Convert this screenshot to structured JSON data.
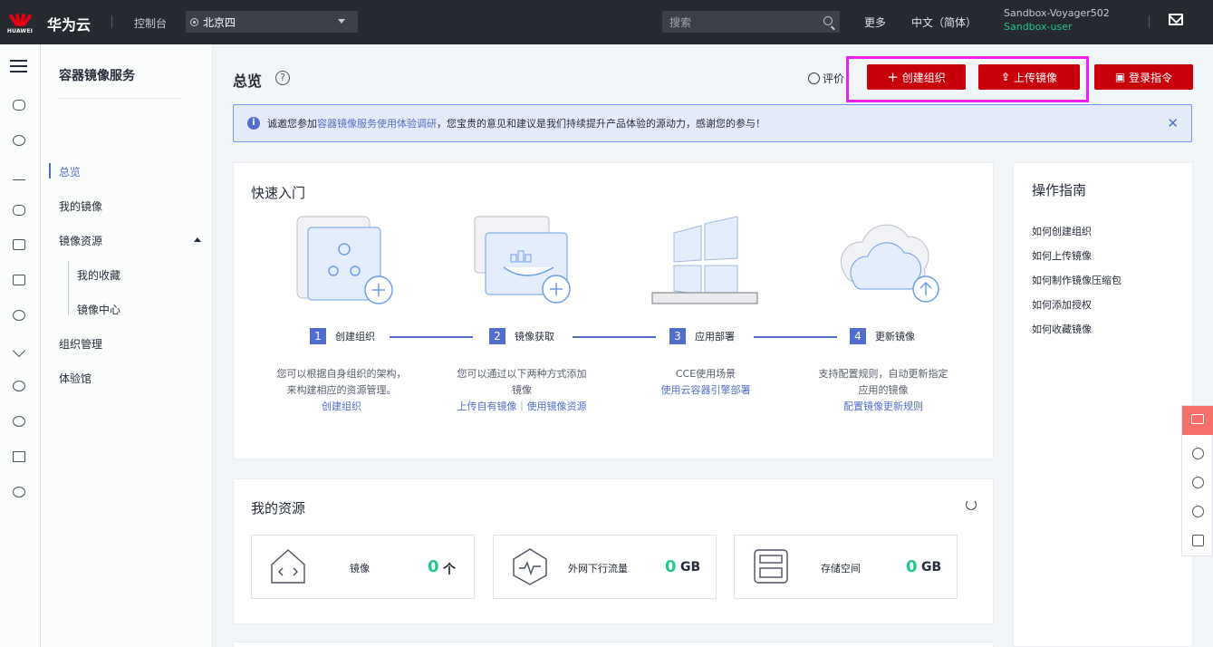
{
  "topbar": {
    "brand": "华为云",
    "logo_caption": "HUAWEI",
    "console": "控制台",
    "region": "北京四",
    "search_placeholder": "搜索",
    "more": "更多",
    "language": "中文（简体）",
    "user_name": "Sandbox-Voyager502",
    "user_role": "Sandbox-user"
  },
  "subnav": {
    "title": "容器镜像服务",
    "items": [
      "总览",
      "我的镜像",
      "镜像资源",
      "我的收藏",
      "镜像中心",
      "组织管理",
      "体验馆"
    ]
  },
  "header": {
    "title": "总览",
    "rate": "评价",
    "create_org": "创建组织",
    "upload_image": "上传镜像",
    "login_cmd": "登录指令"
  },
  "notice": {
    "prefix": "诚邀您参加",
    "link": "容器镜像服务使用体验调研",
    "suffix": "，您宝贵的意见和建议是我们持续提升产品体验的源动力，感谢您的参与！"
  },
  "quickstart": {
    "title": "快速入门",
    "steps": [
      {
        "num": "1",
        "label": "创建组织",
        "desc": "您可以根据自身组织的架构，来构建相应的资源管理。",
        "link": "创建组织"
      },
      {
        "num": "2",
        "label": "镜像获取",
        "desc": "您可以通过以下两种方式添加镜像",
        "link": "上传自有镜像｜使用镜像资源"
      },
      {
        "num": "3",
        "label": "应用部署",
        "desc": "CCE使用场景",
        "link": "使用云容器引擎部署"
      },
      {
        "num": "4",
        "label": "更新镜像",
        "desc": "支持配置规则，自动更新指定应用的镜像",
        "link": "配置镜像更新规则"
      }
    ]
  },
  "resources": {
    "title": "我的资源",
    "items": [
      {
        "label": "镜像",
        "value": "0",
        "unit": "个"
      },
      {
        "label": "外网下行流量",
        "value": "0",
        "unit": "GB"
      },
      {
        "label": "存储空间",
        "value": "0",
        "unit": "GB"
      }
    ]
  },
  "guide": {
    "title": "操作指南",
    "items": [
      "如何创建组织",
      "如何上传镜像",
      "如何制作镜像压缩包",
      "如何添加授权",
      "如何收藏镜像"
    ]
  }
}
